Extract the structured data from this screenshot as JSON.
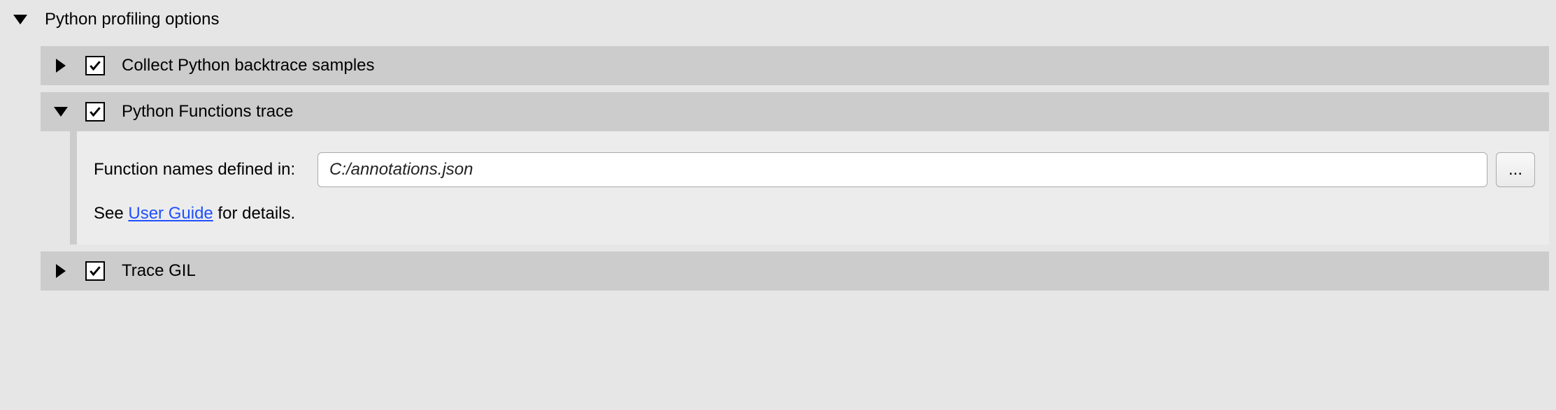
{
  "main_section": {
    "title": "Python profiling options"
  },
  "subsections": {
    "backtrace": {
      "label": "Collect Python backtrace samples",
      "checked": true
    },
    "functions_trace": {
      "label": "Python Functions trace",
      "checked": true,
      "field_label": "Function names defined in:",
      "field_value": "C:/annotations.json",
      "browse_label": "...",
      "help_prefix": "See ",
      "help_link": "User Guide",
      "help_suffix": " for details."
    },
    "trace_gil": {
      "label": "Trace GIL",
      "checked": true
    }
  }
}
